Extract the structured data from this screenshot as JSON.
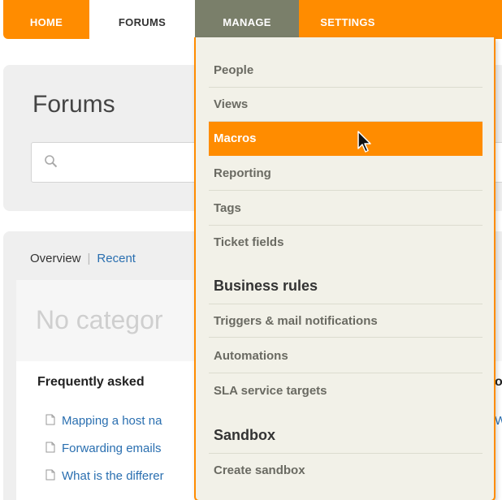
{
  "nav": {
    "home": "HOME",
    "forums": "FORUMS",
    "manage": "MANAGE",
    "settings": "SETTINGS"
  },
  "page": {
    "title": "Forums",
    "overview_tab": "Overview",
    "separator": "|",
    "recent_tab": "Recent",
    "category_title": "No categor",
    "faq_heading": "Frequently asked",
    "articles": [
      "Mapping a host na",
      "Forwarding emails",
      "What is the differer"
    ],
    "right_fragments": [
      "o",
      "W"
    ]
  },
  "menu": {
    "items": [
      "People",
      "Views",
      "Macros",
      "Reporting",
      "Tags",
      "Ticket fields"
    ],
    "active_item": "Macros",
    "business_rules": {
      "heading": "Business rules",
      "items": [
        "Triggers & mail notifications",
        "Automations",
        "SLA service targets"
      ]
    },
    "sandbox": {
      "heading": "Sandbox",
      "items": [
        "Create sandbox"
      ]
    }
  },
  "colors": {
    "accent": "#ff8c00",
    "manage_tab": "#7a7f6a",
    "menu_bg": "#f2f1e8",
    "link": "#2a6fb0"
  }
}
